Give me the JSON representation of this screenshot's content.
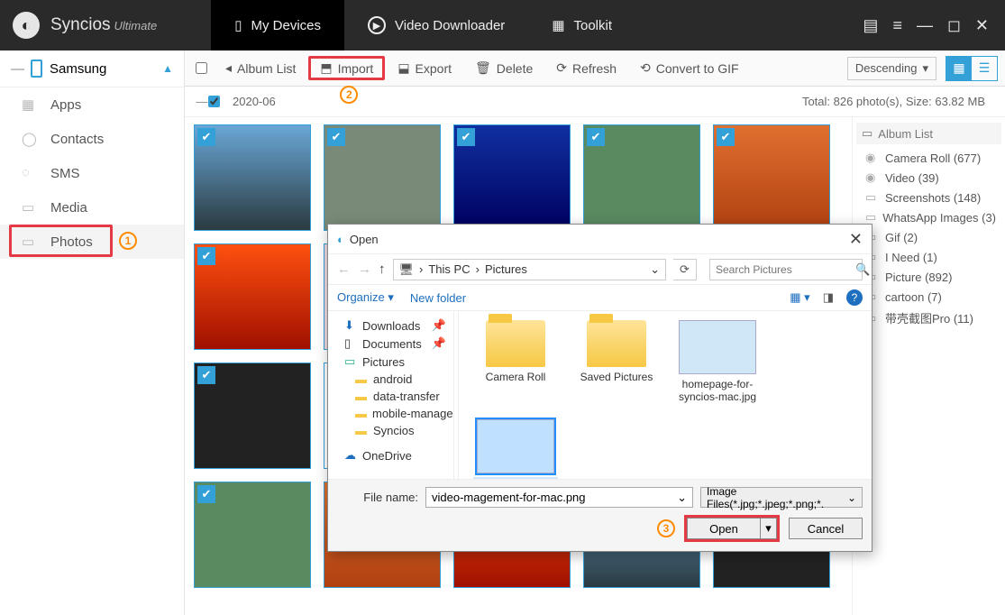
{
  "app": {
    "name": "Syncios",
    "edition": "Ultimate"
  },
  "toptabs": {
    "devices": "My Devices",
    "downloader": "Video Downloader",
    "toolkit": "Toolkit"
  },
  "toolbar": {
    "album_list": "Album List",
    "import": "Import",
    "export": "Export",
    "delete": "Delete",
    "refresh": "Refresh",
    "convert": "Convert to GIF",
    "sort": "Descending"
  },
  "device": {
    "name": "Samsung"
  },
  "sidebar": {
    "apps": "Apps",
    "contacts": "Contacts",
    "sms": "SMS",
    "media": "Media",
    "photos": "Photos"
  },
  "subbar": {
    "date": "2020-06",
    "stats": "Total: 826 photo(s), Size: 63.82 MB"
  },
  "albums_header": "Album List",
  "albums": [
    {
      "label": "Camera Roll (677)"
    },
    {
      "label": "Video (39)"
    },
    {
      "label": "Screenshots (148)"
    },
    {
      "label": "WhatsApp Images (3)"
    },
    {
      "label": "Gif (2)"
    },
    {
      "label": "I Need (1)"
    },
    {
      "label": "Picture (892)"
    },
    {
      "label": "cartoon (7)"
    },
    {
      "label": "带壳截图Pro (11)"
    }
  ],
  "dialog": {
    "title": "Open",
    "path_root": "This PC",
    "path_folder": "Pictures",
    "search_placeholder": "Search Pictures",
    "organize": "Organize",
    "new_folder": "New folder",
    "tree": {
      "downloads": "Downloads",
      "documents": "Documents",
      "pictures": "Pictures",
      "android": "android",
      "data_transfer": "data-transfer",
      "mobile_manage": "mobile-manage",
      "syncios": "Syncios",
      "onedrive": "OneDrive"
    },
    "files": {
      "camera_roll": "Camera Roll",
      "saved_pictures": "Saved Pictures",
      "homepage": "homepage-for-syncios-mac.jpg",
      "videomgmt": "video-magement-for-mac.png"
    },
    "file_name_label": "File name:",
    "file_name_value": "video-magement-for-mac.png",
    "filter": "Image Files(*.jpg;*.jpeg;*.png;*. ",
    "open": "Open",
    "cancel": "Cancel"
  },
  "badges": {
    "one": "1",
    "two": "2",
    "three": "3"
  }
}
